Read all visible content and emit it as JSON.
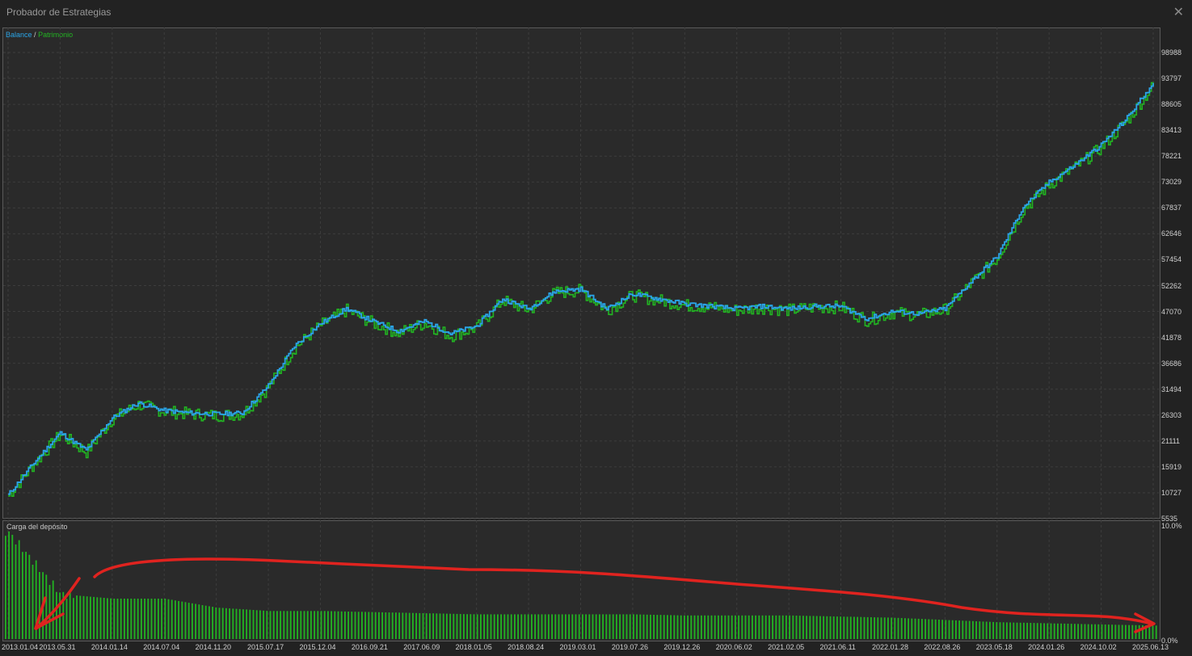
{
  "window": {
    "title": "Probador de Estrategias",
    "close_icon": "close-icon"
  },
  "legend": {
    "balance": "Balance",
    "separator": "/",
    "equity": "Patrimonio"
  },
  "colors": {
    "balance": "#2aa5e8",
    "equity": "#22b422",
    "load_bar": "#22b422",
    "annotation": "#e0231f"
  },
  "load_pane": {
    "title": "Carga del depósito",
    "pct_top": "10.0%",
    "pct_bottom": "0.0%"
  },
  "chart_data": [
    {
      "type": "line",
      "ylim": [
        5535,
        104180
      ],
      "y_ticks": [
        "98988",
        "93797",
        "88605",
        "83413",
        "78221",
        "73029",
        "67837",
        "62646",
        "57454",
        "52262",
        "47070",
        "41878",
        "36686",
        "31494",
        "26303",
        "21111",
        "15919",
        "10727",
        "5535"
      ],
      "x_ticks": [
        "2013.01.04",
        "2013.05.31",
        "2014.01.14",
        "2014.07.04",
        "2014.11.20",
        "2015.07.17",
        "2015.12.04",
        "2016.09.21",
        "2017.06.09",
        "2018.01.05",
        "2018.08.24",
        "2019.03.01",
        "2019.07.26",
        "2019.12.26",
        "2020.06.02",
        "2021.02.05",
        "2021.06.11",
        "2022.01.28",
        "2022.08.26",
        "2023.05.18",
        "2024.01.26",
        "2024.10.02",
        "2025.06.13"
      ],
      "series": [
        {
          "name": "Balance",
          "x": [
            0,
            0.5,
            1,
            1.5,
            2,
            2.5,
            3,
            3.5,
            4,
            4.5,
            5,
            5.5,
            6,
            6.5,
            7,
            7.5,
            8,
            8.5,
            9,
            9.5,
            10,
            10.5,
            11,
            11.5,
            12,
            12.5,
            13,
            13.5,
            14,
            14.5,
            15,
            15.5,
            16,
            16.5,
            17,
            17.5,
            18,
            18.5,
            19,
            19.5,
            20,
            20.5,
            21,
            21.5,
            22
          ],
          "y": [
            10000,
            16500,
            22500,
            19000,
            25500,
            28500,
            27000,
            26500,
            26300,
            26500,
            32000,
            40000,
            44500,
            47500,
            45000,
            43000,
            45000,
            42500,
            44000,
            49500,
            47500,
            51000,
            51500,
            47500,
            50500,
            49500,
            48500,
            48000,
            47500,
            48000,
            47500,
            48000,
            48000,
            45500,
            47000,
            46500,
            47500,
            53000,
            58000,
            68000,
            73000,
            76500,
            80500,
            86000,
            93000
          ]
        },
        {
          "name": "Patrimonio",
          "x": [
            0,
            0.5,
            1,
            1.5,
            2,
            2.5,
            3,
            3.5,
            4,
            4.5,
            5,
            5.5,
            6,
            6.5,
            7,
            7.5,
            8,
            8.5,
            9,
            9.5,
            10,
            10.5,
            11,
            11.5,
            12,
            12.5,
            13,
            13.5,
            14,
            14.5,
            15,
            15.5,
            16,
            16.5,
            17,
            17.5,
            18,
            18.5,
            19,
            19.5,
            20,
            20.5,
            21,
            21.5,
            22
          ],
          "y": [
            9800,
            16300,
            22200,
            18600,
            25300,
            28200,
            26800,
            26300,
            26000,
            26300,
            31700,
            39600,
            44200,
            47200,
            44600,
            42600,
            44600,
            42000,
            43700,
            49200,
            47200,
            50700,
            51200,
            47200,
            50200,
            49200,
            48200,
            47800,
            47200,
            47700,
            47200,
            47800,
            47800,
            45200,
            46700,
            46200,
            47300,
            52700,
            57700,
            67500,
            72500,
            76000,
            80000,
            85500,
            92500
          ]
        }
      ]
    },
    {
      "type": "bar",
      "ylim": [
        0,
        10
      ],
      "series": [
        {
          "name": "Carga del depósito",
          "x": [
            0,
            1,
            2,
            3,
            4,
            5,
            6,
            7,
            8,
            9,
            10,
            11,
            12,
            13,
            14,
            15,
            16,
            17,
            18,
            19,
            20,
            21,
            22
          ],
          "values": [
            9.5,
            4.0,
            3.6,
            3.6,
            2.8,
            2.5,
            2.5,
            2.4,
            2.3,
            2.2,
            2.2,
            2.2,
            2.2,
            2.1,
            2.1,
            2.1,
            2.0,
            1.9,
            1.7,
            1.5,
            1.4,
            1.3,
            1.2
          ]
        }
      ]
    }
  ]
}
